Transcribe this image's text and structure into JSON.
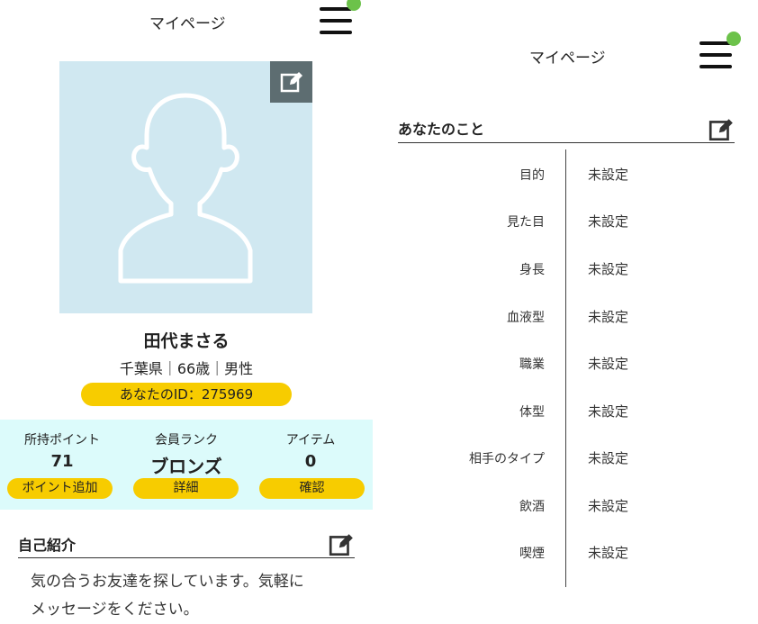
{
  "left": {
    "header": {
      "title": "マイページ"
    },
    "profile": {
      "name": "田代まさる",
      "meta": "千葉県｜66歳｜男性",
      "id_label": "あなたのID：275969"
    },
    "stats": [
      {
        "label": "所持ポイント",
        "value": "71",
        "button": "ポイント追加"
      },
      {
        "label": "会員ランク",
        "value": "ブロンズ",
        "button": "詳細"
      },
      {
        "label": "アイテム",
        "value": "0",
        "button": "確認"
      }
    ],
    "intro": {
      "title": "自己紹介",
      "text_line1": "気の合うお友達を探しています。気軽に",
      "text_line2": "メッセージをください。"
    }
  },
  "right": {
    "header": {
      "title": "マイページ"
    },
    "about": {
      "title": "あなたのこと",
      "rows": [
        {
          "label": "目的",
          "value": "未設定"
        },
        {
          "label": "見た目",
          "value": "未設定"
        },
        {
          "label": "身長",
          "value": "未設定"
        },
        {
          "label": "血液型",
          "value": "未設定"
        },
        {
          "label": "職業",
          "value": "未設定"
        },
        {
          "label": "体型",
          "value": "未設定"
        },
        {
          "label": "相手のタイプ",
          "value": "未設定"
        },
        {
          "label": "飲酒",
          "value": "未設定"
        },
        {
          "label": "喫煙",
          "value": "未設定"
        }
      ]
    }
  },
  "colors": {
    "accent_yellow": "#f7cc00",
    "avatar_bg": "#d0e8f1",
    "stats_bg": "#dcfbfb",
    "notify_green": "#6cc24a"
  }
}
